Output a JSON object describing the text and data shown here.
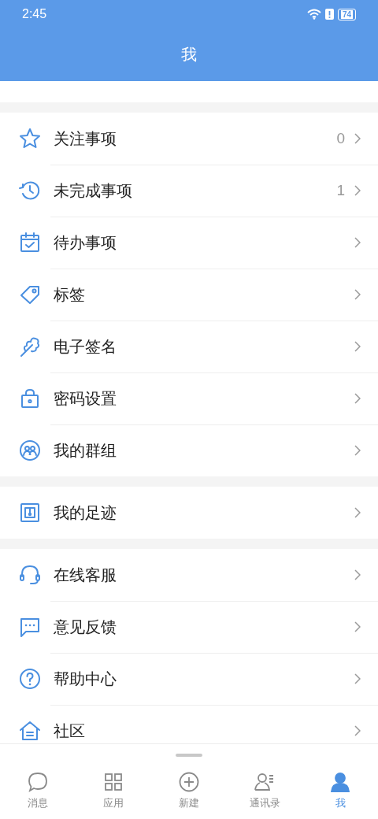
{
  "status_bar": {
    "time": "2:45",
    "battery": "74"
  },
  "header": {
    "title": "我"
  },
  "sections": [
    {
      "items": [
        {
          "label": "关注事项",
          "count": "0"
        },
        {
          "label": "未完成事项",
          "count": "1"
        },
        {
          "label": "待办事项"
        },
        {
          "label": "标签"
        },
        {
          "label": "电子签名"
        },
        {
          "label": "密码设置"
        },
        {
          "label": "我的群组"
        }
      ]
    },
    {
      "items": [
        {
          "label": "我的足迹"
        }
      ]
    },
    {
      "items": [
        {
          "label": "在线客服"
        },
        {
          "label": "意见反馈"
        },
        {
          "label": "帮助中心"
        },
        {
          "label": "社区"
        }
      ]
    }
  ],
  "bottom_nav": [
    {
      "label": "消息",
      "selected": false
    },
    {
      "label": "应用",
      "selected": false
    },
    {
      "label": "新建",
      "selected": false
    },
    {
      "label": "通讯录",
      "selected": false
    },
    {
      "label": "我",
      "selected": true
    }
  ]
}
